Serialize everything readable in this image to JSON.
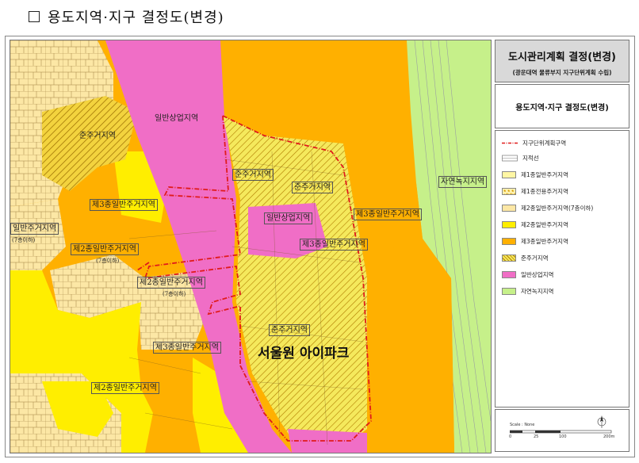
{
  "page": {
    "heading": "용도지역·지구 결정도(변경)"
  },
  "colors": {
    "general_commercial": "#f06ec6",
    "third_residential": "#ffb000",
    "second_residential": "#ffee00",
    "second_residential_7f": "#fce7a5",
    "first_residential": "#fff6a4",
    "semi_residential_base": "#f5e95c",
    "natural_green": "#c6f08a",
    "district_boundary": "#e01b1b"
  },
  "map": {
    "labels": {
      "semi_res_nw": "준주거지역",
      "commercial_top": "일반상업지역",
      "semi_res_center": "준주거지역",
      "semi_res_small": "준주거지역",
      "commercial_center": "일반상업지역",
      "third_west": "제3종일반주거지역",
      "third_east": "제3종일반주거지역",
      "third_center": "제3종일반주거지역",
      "first_left": "일반주거지역",
      "first_left_sub": "(7층이하)",
      "second_left": "제2종일반주거지역",
      "second_left_sub": "(7층이하)",
      "second_mid": "제2종일반주거지역",
      "second_mid_sub": "(7층이하)",
      "third_south": "제3종일반주거지역",
      "semi_res_south": "준주거지역",
      "second_south": "제2종일반주거지역",
      "green": "자연녹지지역",
      "landmark": "서울원 아이파크"
    }
  },
  "legend": {
    "title": "도시관리계획 결정(변경)",
    "subtitle": "(광운대역 물류부지 지구단위계획 수립)",
    "map_name": "용도지역·지구 결정도(변경)",
    "items": [
      {
        "label": "지구단위계획구역",
        "icon": "district-boundary-line"
      },
      {
        "label": "지적선",
        "icon": "parcel-line"
      },
      {
        "label": "제1종일반주거지역",
        "color": "#fff6a4"
      },
      {
        "label": "제1종전용주거지역",
        "color": "#fff2b0",
        "pattern": "dots"
      },
      {
        "label": "제2종일반주거지역(7층이하)",
        "color": "#fce7a5"
      },
      {
        "label": "제2종일반주거지역",
        "color": "#ffee00"
      },
      {
        "label": "제3종일반주거지역",
        "color": "#ffb000"
      },
      {
        "label": "준주거지역",
        "color": "#f5e95c",
        "pattern": "hatch"
      },
      {
        "label": "일반상업지역",
        "color": "#f06ec6"
      },
      {
        "label": "자연녹지지역",
        "color": "#c6f08a"
      }
    ],
    "scale": {
      "label": "Scale : None",
      "ticks": [
        "0",
        "25",
        "100",
        "200m"
      ],
      "north": "north-arrow-icon"
    }
  }
}
